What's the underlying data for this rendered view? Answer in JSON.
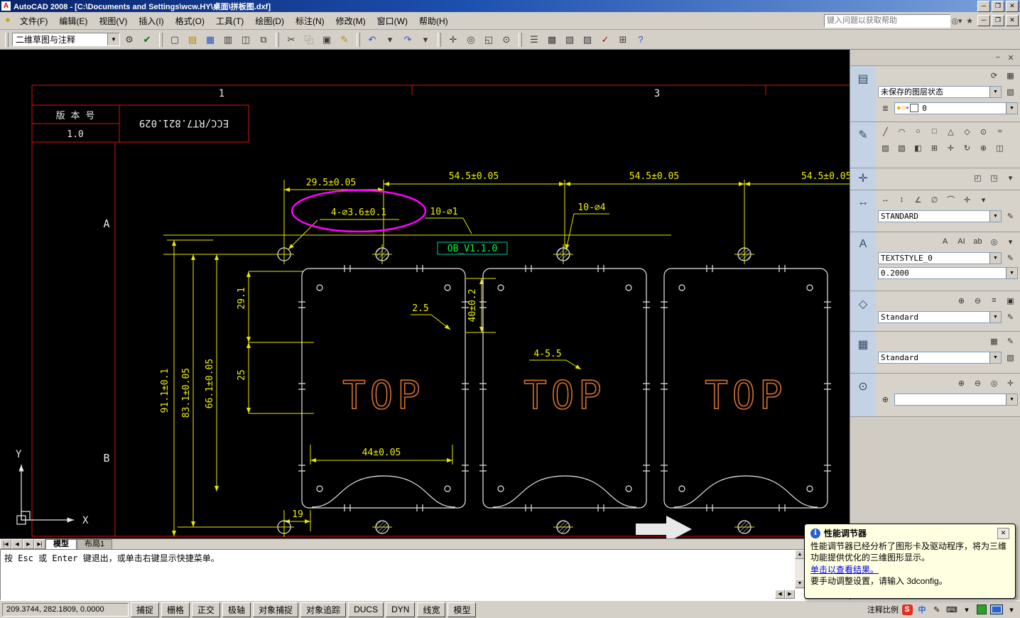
{
  "window": {
    "title": "AutoCAD 2008 - [C:\\Documents and Settings\\wcw.HY\\桌面\\拼板图.dxf]"
  },
  "menu": {
    "items": [
      "文件(F)",
      "编辑(E)",
      "视图(V)",
      "插入(I)",
      "格式(O)",
      "工具(T)",
      "绘图(D)",
      "标注(N)",
      "修改(M)",
      "窗口(W)",
      "帮助(H)"
    ],
    "search_placeholder": "键入问题以获取帮助"
  },
  "toolbar": {
    "workspace": "二维草图与注释"
  },
  "dashboard": {
    "layer_state": "未保存的图层状态",
    "layer_current": "0",
    "dim_style": "STANDARD",
    "text_style": "TEXTSTYLE_0",
    "text_height": "0.2000",
    "mleader_style": "Standard",
    "table_style": "Standard"
  },
  "cad": {
    "grid": {
      "col1": "1",
      "col3": "3",
      "rowA": "A",
      "rowB": "B"
    },
    "titleblock": {
      "label": "版 本 号",
      "version": "1.0",
      "code": "ECC/RT7.821.029"
    },
    "dims": {
      "top1": "29.5±0.05",
      "top2": "54.5±0.05",
      "top3": "54.5±0.05",
      "top4": "54.5±0.05",
      "holes": "4-∅3.6±0.1",
      "n10d1": "10-∅1",
      "n10d4": "10-∅4",
      "ob": "OB_V1.1.0",
      "v1": "91.1±0.1",
      "v2": "83.1±0.05",
      "v3": "66.1±0.05",
      "v4": "29.1",
      "v5": "25",
      "d25": "2.5",
      "d40": "40±0.2",
      "n455": "4-5.5",
      "d44": "44±0.05",
      "d19": "19",
      "top_label": "TOP",
      "x": "X",
      "y": "Y"
    }
  },
  "tabs": {
    "model": "模型",
    "layout": "布局1"
  },
  "command": {
    "prompt": "按 Esc 或 Enter 键退出，或单击右键显示快捷菜单。"
  },
  "statusbar": {
    "coords": "209.3744, 282.1809, 0.0000",
    "toggles": [
      "捕捉",
      "栅格",
      "正交",
      "极轴",
      "对象捕捉",
      "对象追踪",
      "DUCS",
      "DYN",
      "线宽",
      "模型"
    ],
    "annotation": "注释比例"
  },
  "balloon": {
    "title": "性能调节器",
    "body": "性能调节器已经分析了图形卡及驱动程序，将为三维功能提供优化的三维图形显示。",
    "link": "单击以查看结果。",
    "footer": "要手动调整设置，请输入 3dconfig。"
  }
}
